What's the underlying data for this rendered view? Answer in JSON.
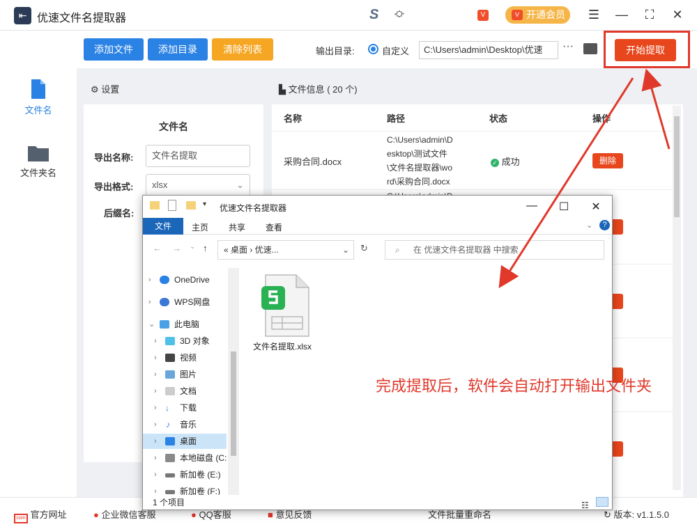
{
  "app": {
    "title": "优速文件名提取器",
    "vip_label": "开通会员",
    "colors": {
      "accent": "#2a82e4",
      "start": "#e8461c",
      "clear": "#f5a623",
      "annotation": "#e0382a"
    }
  },
  "sidebar": {
    "items": [
      {
        "label": "文件名",
        "icon": "file-icon"
      },
      {
        "label": "文件夹名",
        "icon": "folder-icon"
      }
    ]
  },
  "toolbar": {
    "add_file": "添加文件",
    "add_dir": "添加目录",
    "clear_list": "清除列表",
    "output_label": "输出目录:",
    "radio_label": "自定义",
    "output_path": "C:\\Users\\admin\\Desktop\\优速",
    "more": "···",
    "start": "开始提取"
  },
  "settings": {
    "header": "设置",
    "subtitle": "文件名",
    "export_name_label": "导出名称:",
    "export_name_value": "文件名提取",
    "export_format_label": "导出格式:",
    "export_format_value": "xlsx",
    "suffix_label": "后缀名:"
  },
  "fileinfo": {
    "header": "文件信息 ( 20 个)",
    "columns": [
      "名称",
      "路径",
      "状态",
      "操作"
    ],
    "row1": {
      "name": "采购合同.docx",
      "path_lines": [
        "C:\\Users\\admin\\D",
        "esktop\\测试文件",
        "\\文件名提取器\\wo",
        "rd\\采购合同.docx"
      ],
      "status": "成功",
      "action": "删除"
    },
    "row2_path_partial": "C:\\Users\\admin\\D",
    "partial_action": "除"
  },
  "bottombar": {
    "website": "官方网址",
    "wechat": "企业微信客服",
    "qq": "QQ客服",
    "feedback": "意见反馈",
    "batch": "文件批量重命名",
    "version": "版本: v1.1.5.0"
  },
  "explorer": {
    "title": "优速文件名提取器",
    "tabs": [
      "文件",
      "主页",
      "共享",
      "查看"
    ],
    "address": "« 桌面 › 优速...",
    "search_placeholder": "在 优速文件名提取器 中搜索",
    "tree": [
      "OneDrive",
      "WPS网盘",
      "此电脑",
      "3D 对象",
      "视频",
      "图片",
      "文档",
      "下载",
      "音乐",
      "桌面",
      "本地磁盘 (C:",
      "新加卷 (E:)",
      "新加卷 (F:)"
    ],
    "file_name": "文件名提取.xlsx",
    "status": "1 个项目",
    "annotation": "完成提取后，软件会自动打开输出文件夹"
  }
}
